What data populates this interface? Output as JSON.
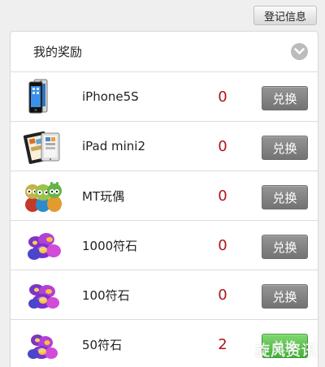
{
  "top_button": {
    "label": "登记信息"
  },
  "rewards": {
    "title": "我的奖励",
    "items": [
      {
        "icon": "iphone-icon",
        "name": "iPhone5S",
        "count": "0",
        "button_label": "兑换",
        "button_state": "disabled"
      },
      {
        "icon": "ipad-mini-icon",
        "name": "iPad mini2",
        "count": "0",
        "button_label": "兑换",
        "button_state": "disabled"
      },
      {
        "icon": "toy-figures-icon",
        "name": "MT玩偶",
        "count": "0",
        "button_label": "兑换",
        "button_state": "disabled"
      },
      {
        "icon": "rune-stones-icon",
        "name": "1000符石",
        "count": "0",
        "button_label": "兑换",
        "button_state": "disabled"
      },
      {
        "icon": "rune-stones-icon",
        "name": "100符石",
        "count": "0",
        "button_label": "兑换",
        "button_state": "disabled"
      },
      {
        "icon": "rune-stones-icon",
        "name": "50符石",
        "count": "2",
        "button_label": "兑换",
        "button_state": "enabled"
      }
    ]
  },
  "watermark": "旋风资讯",
  "colors": {
    "page_background": "#efefef",
    "count_red": "#b1141b",
    "button_gray": "#7d7d7d",
    "button_green": "#5cc34d"
  }
}
